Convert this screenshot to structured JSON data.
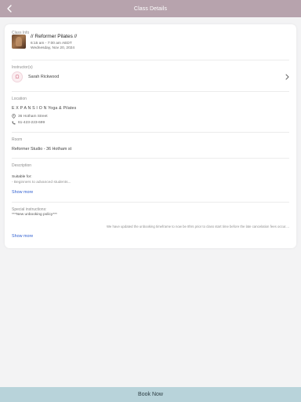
{
  "header": {
    "title": "Class Details"
  },
  "class_info": {
    "label": "Class Info",
    "name": "// Reformer Pilates //",
    "time": "6:15 am - 7:00 am AEDT",
    "date": "Wednesday, Nov 20, 2024"
  },
  "instructor": {
    "label": "Instructor(s)",
    "name": "Sarah Rickwood",
    "avatar_glyph": "Ω"
  },
  "location": {
    "label": "Location",
    "name": "E X P A N S I O N Yoga & Pilates",
    "address": "36 Hotham Street",
    "phone": "61-423-223-699"
  },
  "room": {
    "label": "Room",
    "name": "Reformer Studio - 36 Hotham st"
  },
  "description": {
    "label": "Description",
    "heading": "Suitable for:",
    "text": "- Beginners to advanced students...",
    "show_more": "Show more"
  },
  "special_instructions": {
    "label": "Special instructions:",
    "line1": "***New unbooking policy***",
    "line2": "We have updated the unbooking timeframe to now be 8hrs prior to class start time before the late cancelation fees occur....",
    "show_more": "Show more"
  },
  "footer": {
    "book_label": "Book Now"
  },
  "colors": {
    "header_bg": "#b7a3ad",
    "footer_bg": "#b8d3da",
    "link": "#2f5fd0"
  }
}
